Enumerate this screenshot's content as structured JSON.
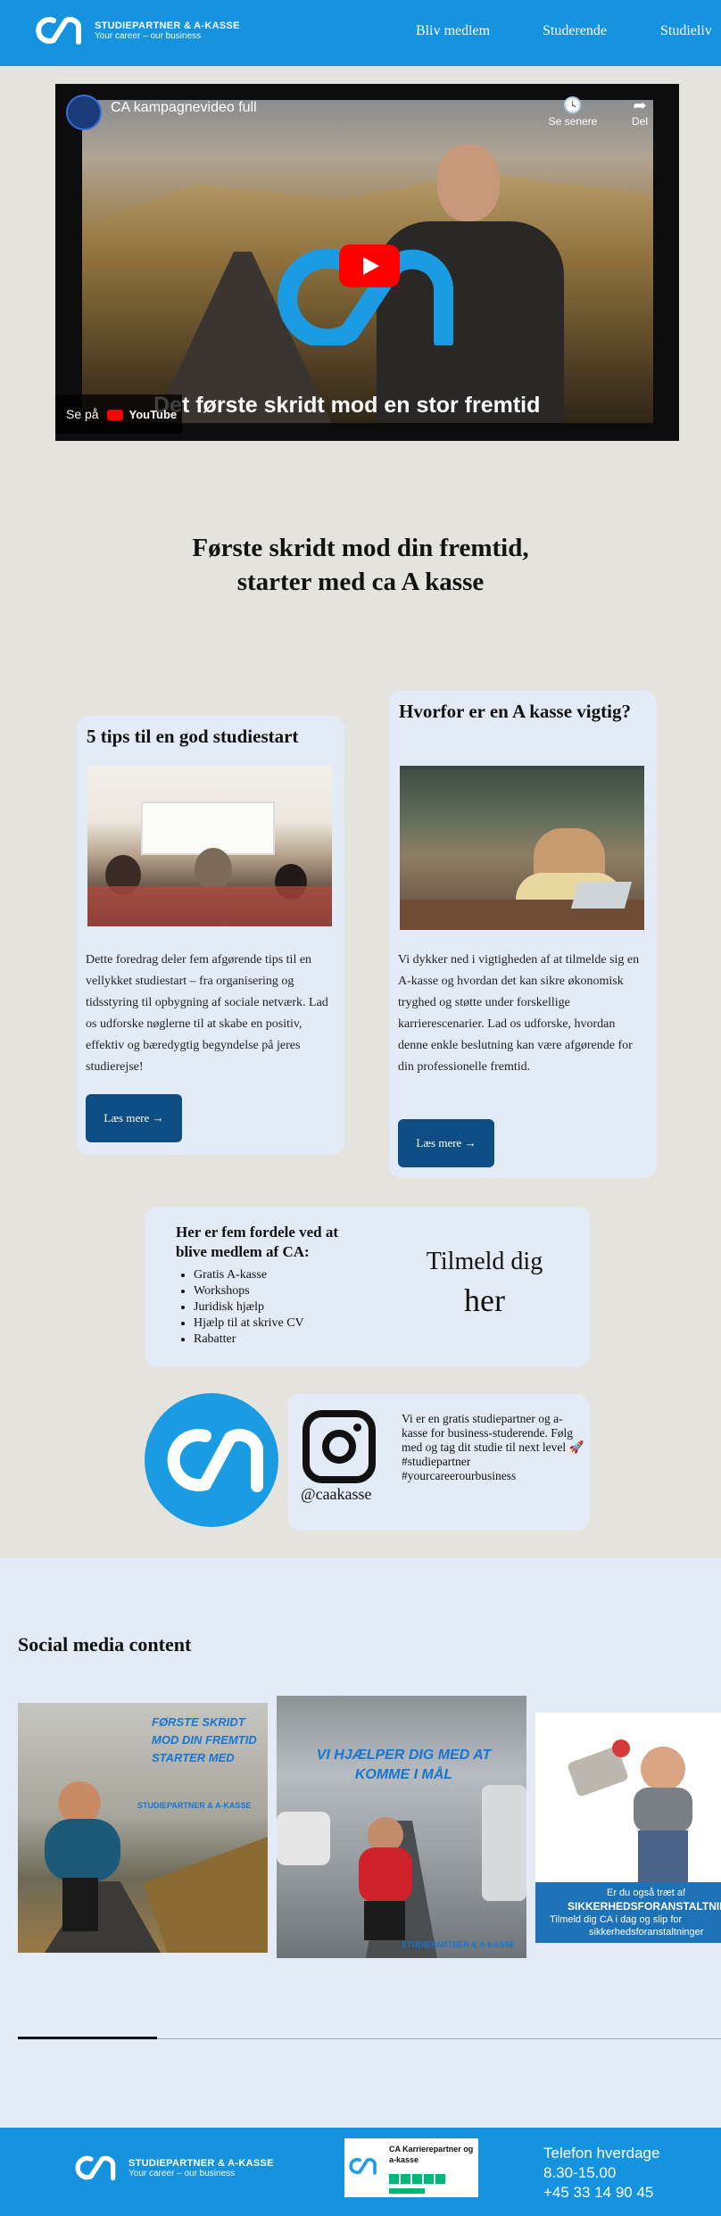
{
  "header": {
    "logo_line1": "STUDIEPARTNER & A-KASSE",
    "logo_line2": "Your career – our business",
    "nav": [
      "Bliv medlem",
      "Studerende",
      "Studieliv"
    ]
  },
  "video": {
    "title": "CA kampagnevideo full",
    "later_label": "Se senere",
    "share_label": "Del",
    "caption": "Det første skridt mod en stor fremtid",
    "watch_on": "Se på",
    "youtube": "YouTube"
  },
  "headline": {
    "line1": "Første skridt mod din fremtid,",
    "line2": "starter med ca A kasse"
  },
  "cards": [
    {
      "title": "5 tips til en god studiestart",
      "body": "Dette foredrag deler fem afgørende tips til en vellykket studiestart – fra organisering og tidsstyring til opbygning af sociale netværk. Lad os udforske nøglerne til at skabe en positiv, effektiv og bæredygtig begyndelse på jeres studierejse!",
      "button": "Læs mere →"
    },
    {
      "title": "Hvorfor er en A kasse vigtig?",
      "body": "Vi dykker ned i vigtigheden af at tilmelde sig en A-kasse og hvordan det kan sikre økonomisk tryghed og støtte under forskellige karrierescenarier. Lad os udforske, hvordan denne enkle beslutning kan være afgørende for din professionelle fremtid.",
      "button": "Læs mere →"
    }
  ],
  "benefits": {
    "title": "Her er fem fordele ved at blive medlem af CA:",
    "items": [
      "Gratis A-kasse",
      "Workshops",
      "Juridisk hjælp",
      "Hjælp til at skrive CV",
      "Rabatter"
    ],
    "signup_line1": "Tilmeld dig",
    "signup_line2": "her"
  },
  "instagram": {
    "handle": "@caakasse",
    "text": "Vi er en gratis studiepartner og a-kasse for business-studerende. Følg med og tag dit studie til next level 🚀 #studiepartner #yourcareerourbusiness"
  },
  "social": {
    "title": "Social media content",
    "post1_text": "FØRSTE SKRIDT MOD DIN FREMTID STARTER MED",
    "post1_logo": "STUDIEPARTNER & A-KASSE",
    "post2_text": "VI HJÆLPER DIG MED AT KOMME I MÅL",
    "post2_logo": "STUDIEPARTNER & A-KASSE",
    "post3_line1": "Er du også træt af",
    "post3_line2": "SIKKERHEDSFORANSTALTNINGER",
    "post3_line3": "Tilmeld dig CA i dag og slip for",
    "post3_line4": "sikkerhedsforanstaltninger"
  },
  "footer": {
    "logo_line1": "STUDIEPARTNER & A-KASSE",
    "logo_line2": "Your career – our business",
    "trust_title": "CA Karrierepartner og a-kasse",
    "phone_label": "Telefon hverdage",
    "phone_hours": "8.30-15.00",
    "phone_number": "+45 33 14 90 45"
  },
  "colors": {
    "brand_blue": "#1593de",
    "button_blue": "#0f4e85",
    "card_bg": "#e3ecf6",
    "page_bg": "#e5e3dd"
  }
}
